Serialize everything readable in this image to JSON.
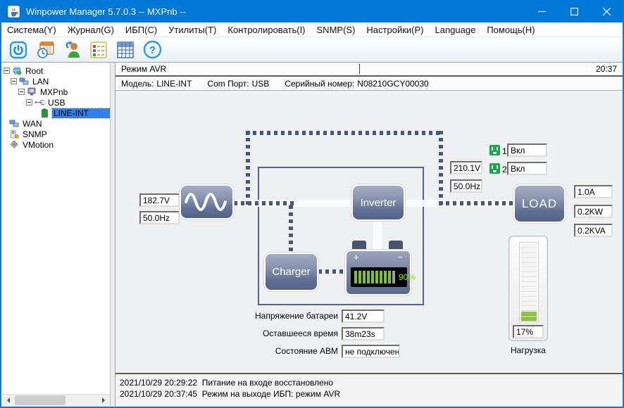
{
  "window": {
    "title": "Winpower Manager 5.7.0.3 -- MXPnb --",
    "icons": [
      "java-app-icon",
      "minimize-icon",
      "maximize-icon",
      "close-icon"
    ]
  },
  "menu": {
    "items": [
      {
        "label": "Система(Y)"
      },
      {
        "label": "Журнал(G)"
      },
      {
        "label": "ИБП(С)"
      },
      {
        "label": "Утилиты(Т)"
      },
      {
        "label": "Контролировать(I)"
      },
      {
        "label": "SNMP(S)"
      },
      {
        "label": "Настройки(P)"
      },
      {
        "label": "Language"
      },
      {
        "label": "Помощь(H)"
      }
    ]
  },
  "toolbar": {
    "icons": [
      "power-icon",
      "schedule-icon",
      "user-manager-icon",
      "event-records-icon",
      "data-table-icon",
      "help-icon"
    ]
  },
  "tree": {
    "items": [
      {
        "label": "Root"
      },
      {
        "label": "LAN"
      },
      {
        "label": "MXPnb"
      },
      {
        "label": "USB"
      },
      {
        "label": "LINE-INT"
      },
      {
        "label": "WAN"
      },
      {
        "label": "SNMP"
      },
      {
        "label": "VMotion"
      }
    ]
  },
  "statusbar": {
    "mode": "Режим AVR",
    "time": "20:37"
  },
  "device_info": {
    "model_label": "Модель:",
    "model": "LINE-INT",
    "port_label": "Com Порт:",
    "port": "USB",
    "serial_label": "Серийный номер:",
    "serial": "N08210GCY00030"
  },
  "diagram": {
    "input": {
      "voltage": "182.7V",
      "frequency": "50.0Hz"
    },
    "output": {
      "voltage": "210.1V",
      "frequency": "50.0Hz"
    },
    "outlets": [
      {
        "id": "1",
        "status": "Вкл"
      },
      {
        "id": "2",
        "status": "Вкл"
      }
    ],
    "inverter_label": "Inverter",
    "charger_label": "Charger",
    "load": {
      "label": "LOAD",
      "current": "1.0A",
      "power": "0.2KW",
      "apparent_power": "0.2KVA"
    },
    "battery": {
      "plus": "+",
      "minus": "−",
      "percent": "90%"
    },
    "battery_info": [
      {
        "label": "Напряжение батареи",
        "value": "41.2V"
      },
      {
        "label": "Оставшееся время",
        "value": "38m23s"
      },
      {
        "label": "Состояние ABM",
        "value": "не подключен"
      }
    ],
    "gauge": {
      "value": "17%",
      "label": "Нагрузка"
    }
  },
  "log": {
    "entries": [
      "2021/10/29 20:29:22  Питание на входе восстановлено",
      "2021/10/29 20:37:45  Режим на выходе ИБП: режим AVR"
    ]
  },
  "colors": {
    "titlebar": "#0078d7",
    "box_gradient_top": "#a4adc4",
    "box_gradient_bottom": "#52628b",
    "dotted_line": "#46567c",
    "outlet_green": "#17a74f",
    "battery_bar_green": "#7dc42a",
    "lcd_text_green": "#8ef000",
    "gauge_green": "#8cc63e",
    "selection_blue": "#2f80e8"
  }
}
